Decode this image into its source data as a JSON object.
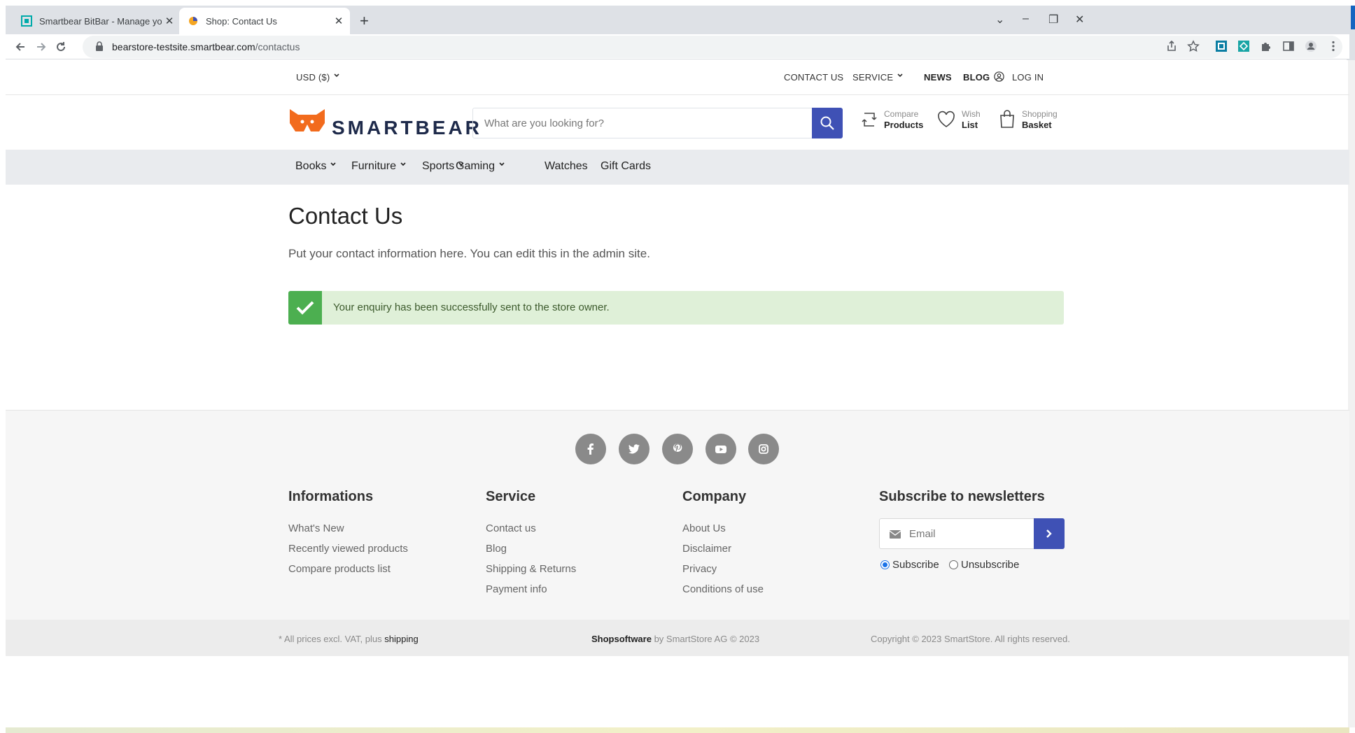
{
  "browser": {
    "tabs": [
      {
        "title": "Smartbear BitBar - Manage your",
        "active": false
      },
      {
        "title": "Shop: Contact Us",
        "active": true
      }
    ],
    "new_tab": "+",
    "url_host": "bearstore-testsite.smartbear.com",
    "url_path": "/contactus",
    "window_controls": {
      "dropdown": "⌄",
      "minimize": "–",
      "restore": "❐",
      "close": "✕"
    },
    "icons": [
      "back-arrow-icon",
      "forward-arrow-icon",
      "reload-icon",
      "lock-icon",
      "share-icon",
      "star-icon",
      "extension-icon",
      "puzzle-icon",
      "sidepanel-icon",
      "profile-icon",
      "kebab-menu-icon"
    ]
  },
  "topbar": {
    "currency": "USD  ($)",
    "links": [
      "CONTACT US",
      "SERVICE",
      "NEWS",
      "BLOG",
      "LOG IN"
    ]
  },
  "header": {
    "logo_text": "SMARTBEAR",
    "search_placeholder": "What are you looking for?",
    "compare": {
      "top": "Compare",
      "bottom": "Products"
    },
    "wishlist": {
      "top": "Wish",
      "bottom": "List"
    },
    "basket": {
      "top": "Shopping",
      "bottom": "Basket"
    }
  },
  "menu": {
    "items": [
      {
        "label": "Books",
        "dropdown": true
      },
      {
        "label": "Furniture",
        "dropdown": true
      },
      {
        "label": "Sports",
        "dropdown": true
      },
      {
        "label": "Gaming",
        "dropdown": true
      },
      {
        "label": "Watches",
        "dropdown": false
      },
      {
        "label": "Gift Cards",
        "dropdown": false
      }
    ]
  },
  "content": {
    "title": "Contact Us",
    "intro": "Put your contact information here. You can edit this in the admin site.",
    "alert": "Your enquiry has been successfully sent to the store owner."
  },
  "footer": {
    "social": [
      "facebook-icon",
      "twitter-icon",
      "pinterest-icon",
      "youtube-icon",
      "instagram-icon"
    ],
    "columns": [
      {
        "title": "Informations",
        "links": [
          "What's New",
          "Recently viewed products",
          "Compare products list"
        ]
      },
      {
        "title": "Service",
        "links": [
          "Contact us",
          "Blog",
          "Shipping & Returns",
          "Payment info"
        ]
      },
      {
        "title": "Company",
        "links": [
          "About Us",
          "Disclaimer",
          "Privacy",
          "Conditions of use"
        ]
      }
    ],
    "newsletter": {
      "title": "Subscribe to newsletters",
      "email_placeholder": "Email",
      "subscribe": "Subscribe",
      "unsubscribe": "Unsubscribe",
      "selected": "Subscribe"
    },
    "bottom": {
      "prices_prefix": "* All prices excl. VAT, plus ",
      "prices_link": "shipping",
      "powered_brand": "Shopsoftware",
      "powered_rest": " by SmartStore AG © 2023",
      "copyright": "Copyright © 2023 SmartStore. All rights reserved."
    }
  },
  "colors": {
    "accent": "#3f51b5",
    "logo_orange": "#f26b1d",
    "success_bg": "#dff0d8",
    "success_icon": "#4caf50"
  }
}
